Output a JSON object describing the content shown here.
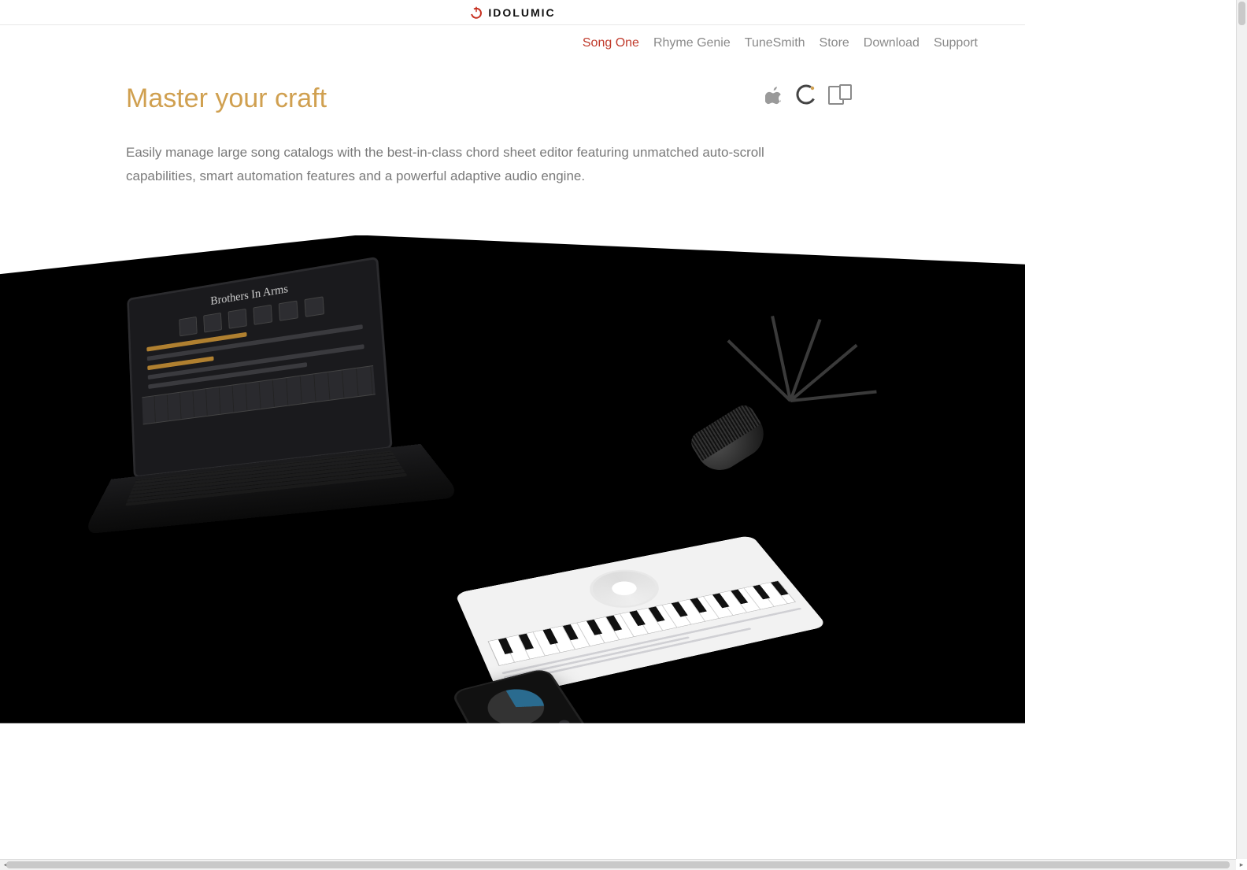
{
  "brand": {
    "name": "IDOLUMIC"
  },
  "nav": {
    "items": [
      {
        "label": "Song One",
        "active": true
      },
      {
        "label": "Rhyme Genie",
        "active": false
      },
      {
        "label": "TuneSmith",
        "active": false
      },
      {
        "label": "Store",
        "active": false
      },
      {
        "label": "Download",
        "active": false
      },
      {
        "label": "Support",
        "active": false
      }
    ]
  },
  "hero": {
    "heading": "Master your craft",
    "description": "Easily manage large song catalogs with the best-in-class chord sheet editor featuring unmatched auto-scroll capabilities, smart automation features and a powerful adaptive audio engine.",
    "song_title_on_screen": "Brothers In Arms"
  },
  "platforms": {
    "icons": [
      "apple-icon",
      "ios-universal-icon",
      "ipad-icon"
    ]
  },
  "colors": {
    "accent_nav_active": "#c03a2b",
    "heading": "#d0a050",
    "body_text": "#7a7a7a"
  }
}
